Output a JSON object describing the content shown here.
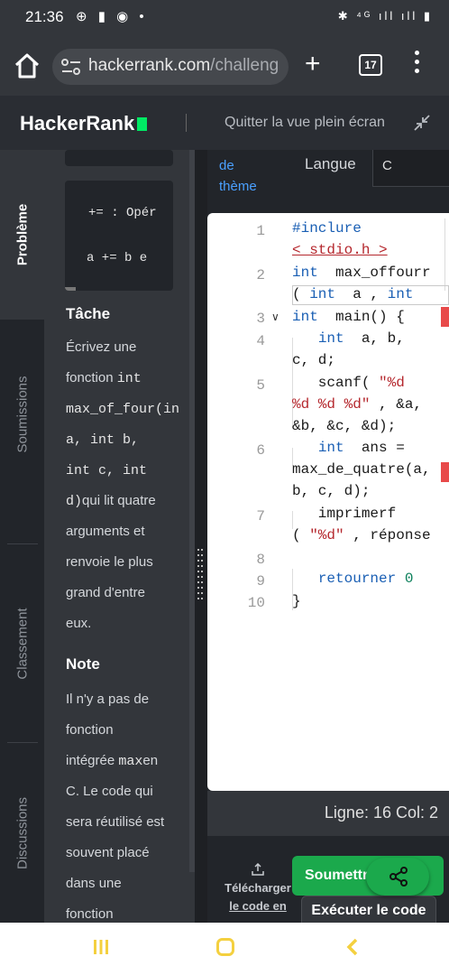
{
  "status": {
    "time": "21:36",
    "left_icons": "⊕ ▮ ◉ •",
    "right_icons": "✱ ⁴ᴳ ıll ıll ▮"
  },
  "browser": {
    "url_host": "hackerrank.com",
    "url_rest": "/challeng",
    "tab_count": "17"
  },
  "header": {
    "logo": "HackerRank",
    "exit_fullscreen": "Quitter la vue plein écran"
  },
  "vtabs": [
    "Problème",
    "Soumissions",
    "Classement",
    "Discussions"
  ],
  "problem": {
    "snippet_lines": [
      "+= : Opér",
      "a += b e"
    ],
    "task_heading": "Tâche",
    "task_lines": [
      {
        "text": "Écrivez une",
        "mono": ""
      },
      {
        "text": "fonction ",
        "mono": "int"
      },
      {
        "text": "",
        "mono": "max_of_four(in"
      },
      {
        "text": "",
        "mono": "a, int b,"
      },
      {
        "text": "",
        "mono": "int c, int"
      },
      {
        "text": "",
        "mono": "d)",
        "after": "qui lit quatre"
      },
      {
        "text": "arguments et",
        "mono": ""
      },
      {
        "text": "renvoie le plus",
        "mono": ""
      },
      {
        "text": "grand d'entre",
        "mono": ""
      },
      {
        "text": "eux.",
        "mono": ""
      }
    ],
    "note_heading": "Note",
    "note_lines": [
      {
        "text": "Il n'y a pas de",
        "mono": ""
      },
      {
        "text": "fonction",
        "mono": ""
      },
      {
        "text": "intégrée ",
        "mono": "max",
        "after": "en"
      },
      {
        "text": "C. Le code qui",
        "mono": ""
      },
      {
        "text": "sera réutilisé est",
        "mono": ""
      },
      {
        "text": "souvent placé",
        "mono": ""
      },
      {
        "text": "dans une",
        "mono": ""
      },
      {
        "text": "fonction",
        "mono": ""
      }
    ]
  },
  "editor": {
    "theme_line1": "de",
    "theme_line2": "thème",
    "language_label": "Langue",
    "language_value": "C",
    "line_numbers": [
      "1",
      "2",
      "3",
      "4",
      "5",
      "6",
      "7",
      "8",
      "9",
      "10"
    ],
    "status": "Ligne: 16 Col: 2"
  },
  "actions": {
    "download_line1": "Télécharger",
    "download_line2": "le code en",
    "submit": "Soumettre",
    "run": "Exécuter le code"
  },
  "colors": {
    "brand_green": "#1ba94c",
    "logo_green": "#00ea64",
    "link_blue": "#4aa0ff",
    "nav_yellow": "#f4d03f"
  }
}
